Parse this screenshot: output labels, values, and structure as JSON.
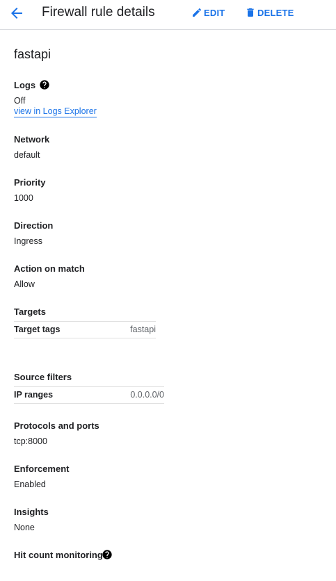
{
  "header": {
    "title": "Firewall rule details",
    "edit_label": "EDIT",
    "delete_label": "DELETE",
    "accent_color": "#1a73e8"
  },
  "rule_name": "fastapi",
  "logs": {
    "label": "Logs",
    "value": "Off",
    "link": "view in Logs Explorer"
  },
  "network": {
    "label": "Network",
    "value": "default"
  },
  "priority": {
    "label": "Priority",
    "value": "1000"
  },
  "direction": {
    "label": "Direction",
    "value": "Ingress"
  },
  "action_on_match": {
    "label": "Action on match",
    "value": "Allow"
  },
  "targets": {
    "label": "Targets",
    "key": "Target tags",
    "value": "fastapi"
  },
  "source_filters": {
    "label": "Source filters",
    "key": "IP ranges",
    "value": "0.0.0.0/0"
  },
  "protocols": {
    "label": "Protocols and ports",
    "value": "tcp:8000"
  },
  "enforcement": {
    "label": "Enforcement",
    "value": "Enabled"
  },
  "insights": {
    "label": "Insights",
    "value": "None"
  },
  "hit_count": {
    "label": "Hit count monitoring"
  }
}
